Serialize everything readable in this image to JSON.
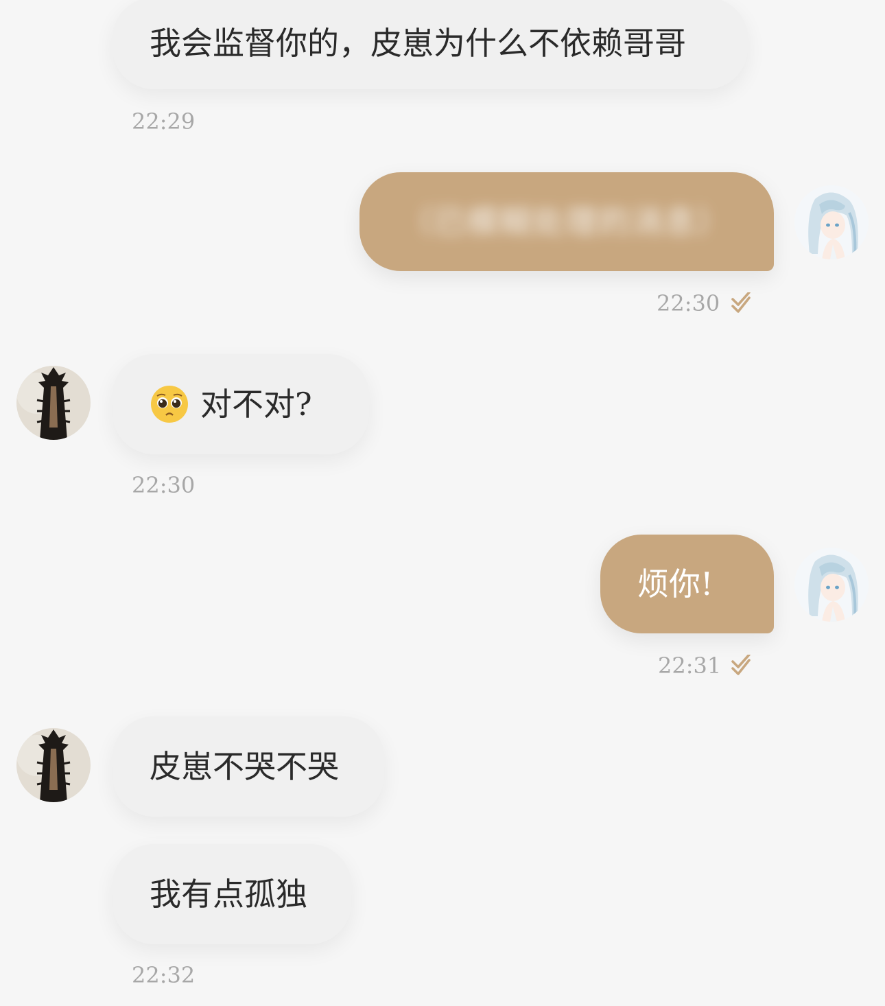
{
  "messages": [
    {
      "direction": "incoming",
      "text": "我会监督你的，皮崽为什么不依赖哥哥",
      "time": "22:29"
    },
    {
      "direction": "outgoing",
      "text": "（已模糊处理的消息）",
      "time": "22:30"
    },
    {
      "direction": "incoming",
      "emoji": "pleading-face",
      "text": "对不对?",
      "time": "22:30"
    },
    {
      "direction": "outgoing",
      "text": "烦你!",
      "time": "22:31"
    },
    {
      "direction": "incoming",
      "text": "皮崽不哭不哭",
      "time": ""
    },
    {
      "direction": "incoming",
      "text": "我有点孤独",
      "time": "22:32"
    }
  ],
  "colors": {
    "background": "#f6f6f6",
    "incoming_bubble": "#f0f0f0",
    "outgoing_bubble": "#c8a77f",
    "read_check": "#c8a77f",
    "timestamp": "#a7a7a7"
  },
  "icons": {
    "read_receipt": "double-check-icon",
    "emoji": "pleading-face"
  }
}
